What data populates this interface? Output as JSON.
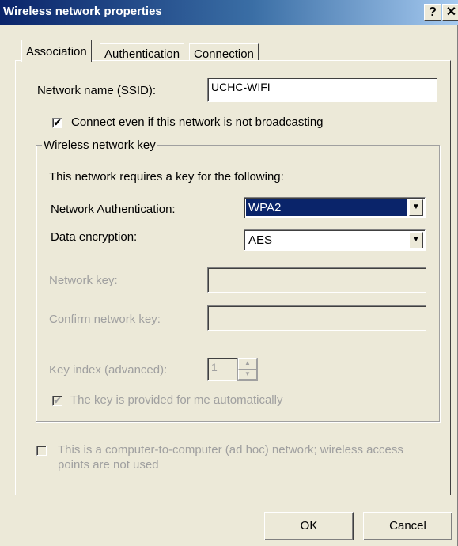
{
  "window": {
    "title": "Wireless network properties",
    "help_button": "?",
    "close_button": "✕"
  },
  "tabs": [
    {
      "label": "Association",
      "active": true
    },
    {
      "label": "Authentication",
      "active": false
    },
    {
      "label": "Connection",
      "active": false
    }
  ],
  "association": {
    "ssid_label": "Network name (SSID):",
    "ssid_value": "UCHC-WIFI",
    "broadcast_checkbox": {
      "label": "Connect even if this network is not broadcasting",
      "checked": true
    },
    "group_title": "Wireless network key",
    "group_intro": "This network requires a key for the following:",
    "auth_label": "Network Authentication:",
    "auth_value": "WPA2",
    "encryption_label": "Data encryption:",
    "encryption_value": "AES",
    "network_key_label": "Network key:",
    "network_key_value": "",
    "confirm_key_label": "Confirm network key:",
    "confirm_key_value": "",
    "key_index_label": "Key index (advanced):",
    "key_index_value": "1",
    "auto_key_checkbox": {
      "label": "The key is provided for me automatically",
      "checked": true
    },
    "adhoc_checkbox": {
      "label_line1": "This is a computer-to-computer (ad hoc) network; wireless access",
      "label_line2": "points are not used",
      "checked": false
    }
  },
  "buttons": {
    "ok": "OK",
    "cancel": "Cancel"
  },
  "colors": {
    "dialog_bg": "#ece9d8",
    "titlebar": "#0a246a",
    "selection": "#0a246a",
    "disabled_text": "#a0a0a0"
  }
}
